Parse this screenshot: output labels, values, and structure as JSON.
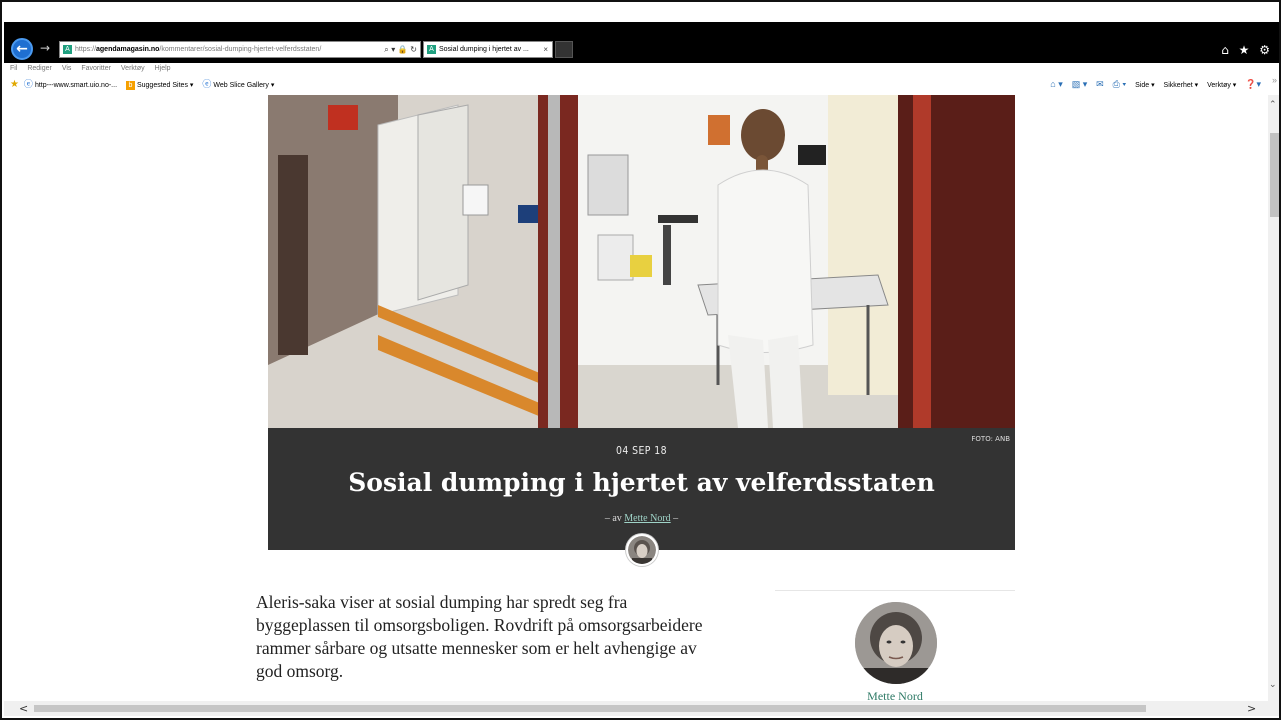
{
  "browser": {
    "address": {
      "protocol": "https://",
      "host": "agendamagasin.no",
      "path": "/kommentarer/sosial-dumping-hjertet-velferdsstaten/",
      "favicon_letter": "A",
      "controls": "⌕ ▾ 🔒 ↻"
    },
    "back_glyph": "←",
    "forward_glyph": "→",
    "tab": {
      "title": "Sosial dumping i hjertet av ...",
      "close_glyph": "×",
      "favicon_letter": "A"
    },
    "right_icons": "⌂ ★ ⚙",
    "menu": [
      "Fil",
      "Rediger",
      "Vis",
      "Favoritter",
      "Verktøy",
      "Hjelp"
    ],
    "favorites": [
      {
        "label": "http---www.smart.uio.no-..."
      },
      {
        "label": "Suggested Sites ▾"
      },
      {
        "label": "Web Slice Gallery ▾"
      }
    ],
    "command_bar": {
      "home": "⌂ ▾",
      "feeds": "▧ ▾",
      "mail": "✉",
      "print": "⎙ ▾",
      "side": "Side ▾",
      "sikkerhet": "Sikkerhet ▾",
      "verktoy": "Verktøy ▾",
      "help": "❓▾",
      "more": "»"
    }
  },
  "article": {
    "photo_credit": "FOTO: ANB",
    "date": "04 SEP 18",
    "title": "Sosial dumping i hjertet av velferdsstaten",
    "byline_prefix": "– av ",
    "author": "Mette Nord",
    "byline_suffix": " –",
    "lead": "Aleris-saka viser at sosial dumping har spredt seg fra byggeplassen til omsorgsboligen. Rovdrift på omsorgsarbeidere rammer sårbare og utsatte mennesker som er helt avhengige av god omsorg."
  },
  "sidebar": {
    "author_name": "Mette Nord"
  },
  "scroll": {
    "up": "⌃",
    "down": "⌄",
    "left": "<",
    "right": ">"
  }
}
